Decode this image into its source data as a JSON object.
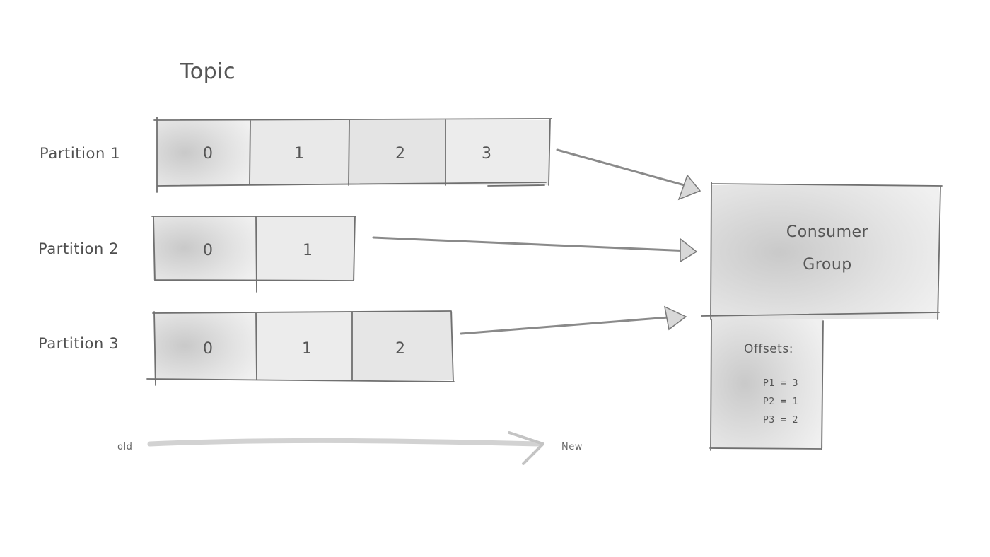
{
  "title": "Topic",
  "partitions": [
    {
      "label": "Partition 1",
      "offsets": [
        "0",
        "1",
        "2",
        "3"
      ]
    },
    {
      "label": "Partition 2",
      "offsets": [
        "0",
        "1"
      ]
    },
    {
      "label": "Partition 3",
      "offsets": [
        "0",
        "1",
        "2"
      ]
    }
  ],
  "axis": {
    "start": "old",
    "end": "New"
  },
  "consumer_group": {
    "title_line1": "Consumer",
    "title_line2": "Group",
    "offsets_title": "Offsets:",
    "offsets": [
      "P1 = 3",
      "P2 = 1",
      "P3 = 2"
    ]
  },
  "colors": {
    "stroke": "#6e6e6e",
    "shade": "#d8d8d8",
    "text": "#555555"
  }
}
